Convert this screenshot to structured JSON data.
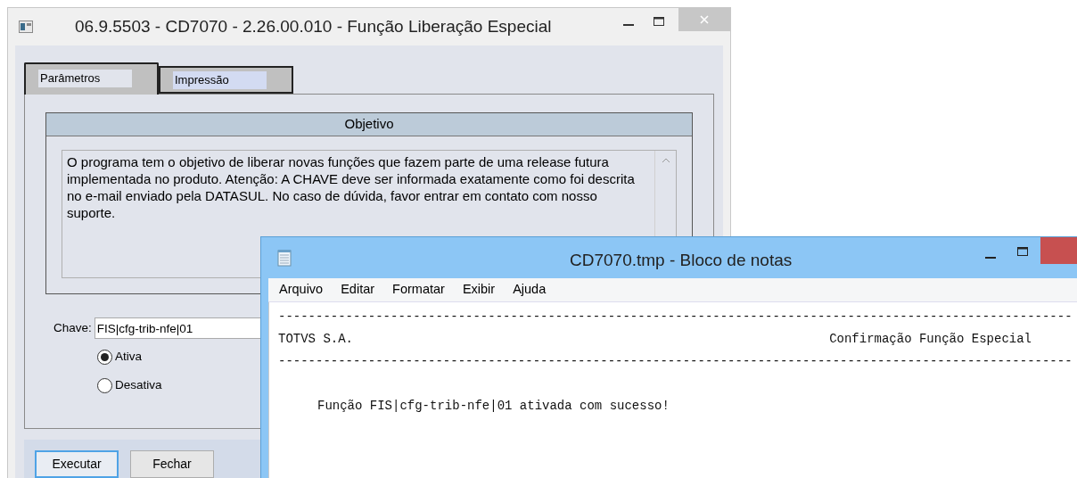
{
  "dialog": {
    "title": "06.9.5503 - CD7070 - 2.26.00.010 - Função Liberação Especial",
    "tabs": [
      {
        "label": "Parâmetros",
        "selected": true
      },
      {
        "label": "Impressão",
        "selected": false
      }
    ],
    "objective": {
      "title": "Objetivo",
      "text": "O programa tem o objetivo de liberar novas funções que fazem parte de uma release futura implementada no produto. Atenção: A CHAVE deve ser informada exatamente como foi descrita no e-mail enviado pela DATASUL. No caso de dúvida, favor entrar em contato com nosso suporte."
    },
    "key_field": {
      "label": "Chave:",
      "value": "FIS|cfg-trib-nfe|01"
    },
    "options": [
      {
        "label": "Ativa",
        "selected": true
      },
      {
        "label": "Desativa",
        "selected": false
      }
    ],
    "buttons": [
      {
        "label": "Executar",
        "focused": true
      },
      {
        "label": "Fechar",
        "focused": false
      }
    ]
  },
  "notepad": {
    "title": "CD7070.tmp - Bloco de notas",
    "menu": [
      "Arquivo",
      "Editar",
      "Formatar",
      "Exibir",
      "Ajuda"
    ],
    "lines": [
      {
        "kind": "rule",
        "text": "----------------------------------------------------------------------------------------------------------"
      },
      {
        "kind": "header",
        "left": "TOTVS S.A.",
        "right": "Confirmação Função Especial"
      },
      {
        "kind": "rule",
        "text": "----------------------------------------------------------------------------------------------------------"
      },
      {
        "kind": "blank"
      },
      {
        "kind": "message",
        "text": "Função FIS|cfg-trib-nfe|01 ativada com sucesso!"
      }
    ]
  }
}
